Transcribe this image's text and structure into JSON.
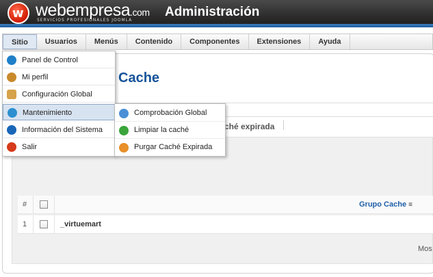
{
  "header": {
    "logo_text": "webempresa",
    "logo_suffix": ".com",
    "logo_tagline": "SERVICIOS PROFESIONALES JOOMLA",
    "title": "Administración"
  },
  "menubar": {
    "items": [
      {
        "label": "Sitio"
      },
      {
        "label": "Usuarios"
      },
      {
        "label": "Menús"
      },
      {
        "label": "Contenido"
      },
      {
        "label": "Componentes"
      },
      {
        "label": "Extensiones"
      },
      {
        "label": "Ayuda"
      }
    ]
  },
  "dropdown": {
    "items": [
      {
        "label": "Panel de Control",
        "icon": "panel-icon",
        "color": "#1f7fc8"
      },
      {
        "label": "Mi perfil",
        "icon": "user-icon",
        "color": "#c98a2c"
      },
      {
        "label": "Configuración Global",
        "icon": "wrench-icon",
        "color": "#d6a24a"
      },
      {
        "label": "Mantenimiento",
        "icon": "gear-icon",
        "color": "#2d8fd0"
      },
      {
        "label": "Información del Sistema",
        "icon": "info-icon",
        "color": "#1a66b8"
      },
      {
        "label": "Salir",
        "icon": "exit-icon",
        "color": "#d63a1a"
      }
    ]
  },
  "submenu": {
    "items": [
      {
        "label": "Comprobación Global",
        "icon": "check-icon",
        "color": "#4a8fd6"
      },
      {
        "label": "Limpiar la caché",
        "icon": "refresh-icon",
        "color": "#3aa53a"
      },
      {
        "label": "Purgar Caché Expirada",
        "icon": "purge-icon",
        "color": "#e8902a"
      }
    ]
  },
  "page": {
    "title": "Cache",
    "sub_tab": "ché expirada",
    "footer": "Mos"
  },
  "table": {
    "headers": {
      "num": "#",
      "group": "Grupo Cache"
    },
    "rows": [
      {
        "num": "1",
        "name": "_virtuemart"
      }
    ]
  }
}
